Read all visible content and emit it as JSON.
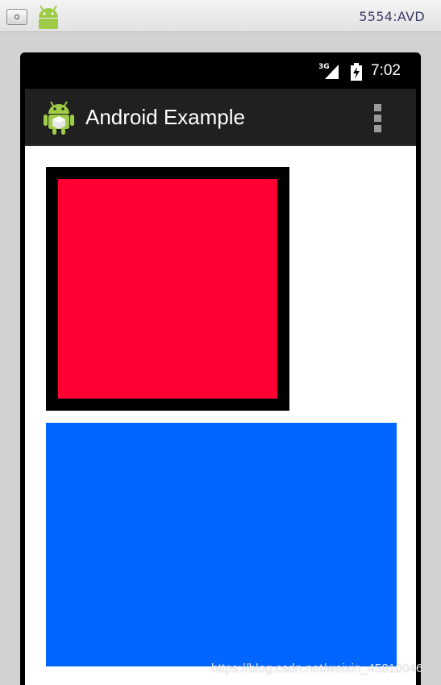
{
  "emulator": {
    "title": "5554:AVD",
    "menu_icon": "emulator-menu-icon",
    "logo_icon": "android-logo-icon"
  },
  "status_bar": {
    "signal_label": "3G",
    "signal_icon": "signal-3g-icon",
    "battery_icon": "battery-charging-icon",
    "time": "7:02"
  },
  "action_bar": {
    "title": "Android Example",
    "app_icon": "android-app-icon",
    "overflow_icon": "overflow-menu-icon"
  },
  "content": {
    "red_box_color": "#ff0033",
    "red_box_border_color": "#000000",
    "blue_box_color": "#0066ff"
  },
  "colors": {
    "action_bar_bg": "#202020",
    "status_bar_bg": "#000000",
    "content_bg": "#ffffff"
  },
  "watermark": "https://blog.csdn.net/weixin_45810046"
}
